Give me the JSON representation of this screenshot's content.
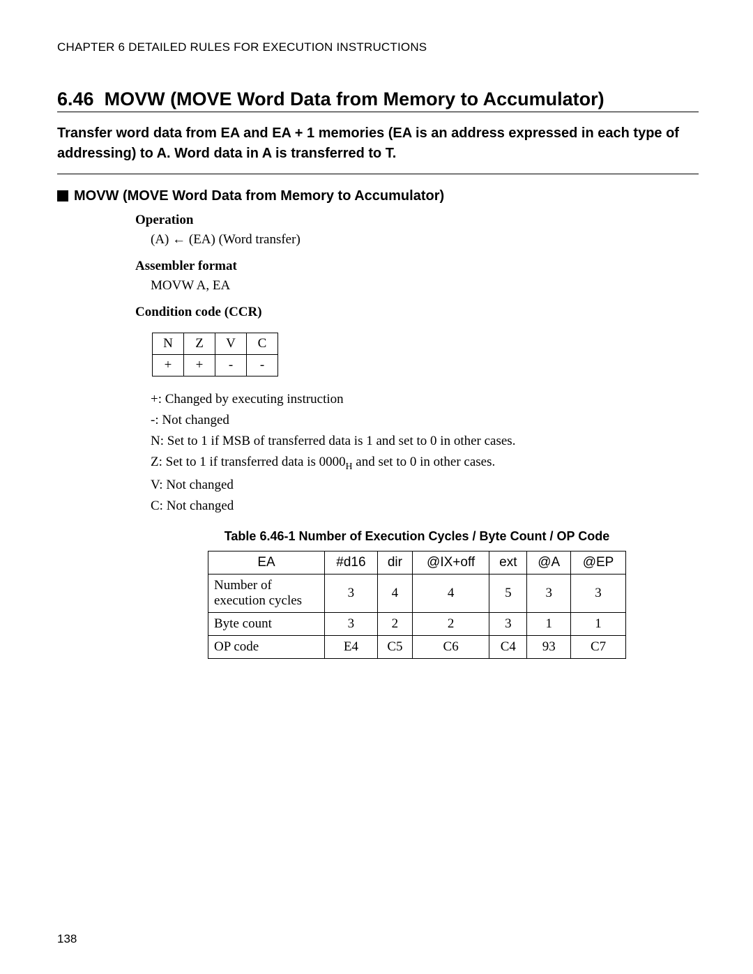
{
  "chapter_header": "CHAPTER 6  DETAILED RULES FOR EXECUTION INSTRUCTIONS",
  "section_number": "6.46",
  "section_title": "MOVW (MOVE Word Data from Memory to Accumulator)",
  "intro": "Transfer word data from EA and EA + 1 memories (EA is an address expressed in each type of addressing) to A. Word data in A is transferred to T.",
  "subheading": "MOVW (MOVE Word Data from Memory to Accumulator)",
  "labels": {
    "operation": "Operation",
    "assembler": "Assembler format",
    "ccr": "Condition code (CCR)"
  },
  "operation_value": "(A) ← (EA) (Word transfer)",
  "assembler_value": "MOVW A, EA",
  "ccr_table": {
    "headers": [
      "N",
      "Z",
      "V",
      "C"
    ],
    "values": [
      "+",
      "+",
      "-",
      "-"
    ]
  },
  "notes": {
    "plus": "+: Changed by executing instruction",
    "minus": "-: Not changed",
    "n": "N: Set to 1 if MSB of transferred data is 1 and set to 0 in other cases.",
    "z_pre": "Z: Set to 1 if transferred data is 0000",
    "z_sub": "H",
    "z_post": " and set to 0 in other cases.",
    "v": "V: Not changed",
    "c": "C: Not changed"
  },
  "table_caption": "Table 6.46-1  Number of Execution Cycles / Byte Count / OP Code",
  "main_table": {
    "col_headers": [
      "EA",
      "#d16",
      "dir",
      "@IX+off",
      "ext",
      "@A",
      "@EP"
    ],
    "rows": [
      {
        "label": "Number of execution cycles",
        "cells": [
          "3",
          "4",
          "4",
          "5",
          "3",
          "3"
        ]
      },
      {
        "label": "Byte count",
        "cells": [
          "3",
          "2",
          "2",
          "3",
          "1",
          "1"
        ]
      },
      {
        "label": "OP code",
        "cells": [
          "E4",
          "C5",
          "C6",
          "C4",
          "93",
          "C7"
        ]
      }
    ]
  },
  "page_number": "138"
}
